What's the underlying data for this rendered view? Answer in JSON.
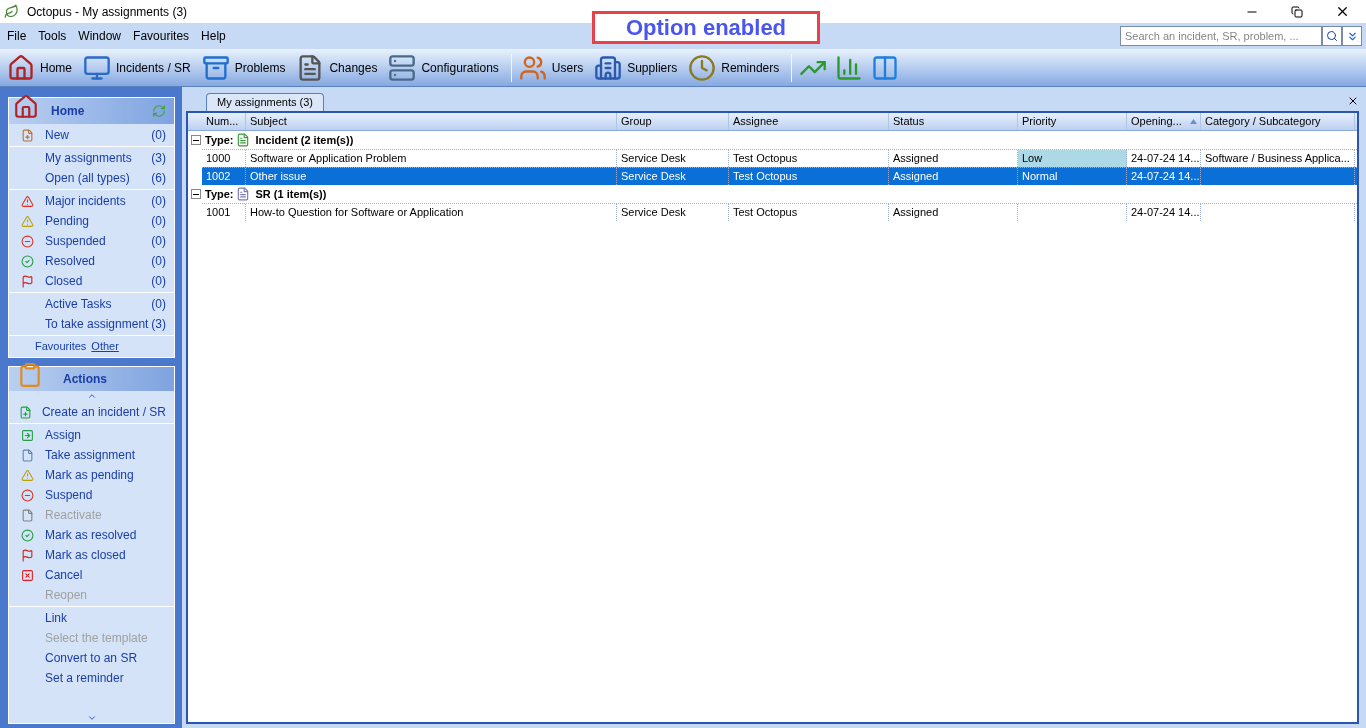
{
  "window": {
    "title": "Octopus - My assignments (3)"
  },
  "annotation": {
    "text": "Option enabled"
  },
  "menu": [
    "File",
    "Tools",
    "Window",
    "Favourites",
    "Help"
  ],
  "search": {
    "placeholder": "Search an incident, SR, problem, ..."
  },
  "toolbar": [
    {
      "kind": "home",
      "label": "Home"
    },
    {
      "kind": "incidents",
      "label": "Incidents / SR"
    },
    {
      "kind": "problems",
      "label": "Problems"
    },
    {
      "kind": "changes",
      "label": "Changes"
    },
    {
      "kind": "configurations",
      "label": "Configurations"
    },
    {
      "kind": "separator"
    },
    {
      "kind": "users",
      "label": "Users"
    },
    {
      "kind": "suppliers",
      "label": "Suppliers"
    },
    {
      "kind": "reminders",
      "label": "Reminders"
    },
    {
      "kind": "separator"
    },
    {
      "kind": "line-chart"
    },
    {
      "kind": "bar-chart"
    },
    {
      "kind": "columns"
    }
  ],
  "home_panel": {
    "title": "Home",
    "groups": [
      [
        {
          "kind": "new",
          "label": "New",
          "count": "(0)"
        }
      ],
      [
        {
          "kind": "plain",
          "label": "My assignments",
          "count": "(3)"
        },
        {
          "kind": "plain",
          "label": "Open (all types)",
          "count": "(6)"
        }
      ],
      [
        {
          "kind": "major",
          "label": "Major incidents",
          "count": "(0)"
        },
        {
          "kind": "pending",
          "label": "Pending",
          "count": "(0)"
        },
        {
          "kind": "suspend",
          "label": "Suspended",
          "count": "(0)"
        },
        {
          "kind": "resolved",
          "label": "Resolved",
          "count": "(0)"
        },
        {
          "kind": "closed",
          "label": "Closed",
          "count": "(0)"
        }
      ],
      [
        {
          "kind": "plain",
          "label": "Active Tasks",
          "count": "(0)"
        },
        {
          "kind": "plain",
          "label": "To take assignment",
          "count": "(3)"
        }
      ]
    ],
    "favourites": "Favourites",
    "other": "Other"
  },
  "actions_panel": {
    "title": "Actions",
    "groups": [
      [
        {
          "kind": "create",
          "label": "Create an incident / SR",
          "disabled": false
        }
      ],
      [
        {
          "kind": "assign",
          "label": "Assign",
          "disabled": false
        },
        {
          "kind": "take",
          "label": "Take assignment",
          "disabled": false
        },
        {
          "kind": "pending",
          "label": "Mark as pending",
          "disabled": false
        },
        {
          "kind": "suspend",
          "label": "Suspend",
          "disabled": false
        },
        {
          "kind": "reactivate",
          "label": "Reactivate",
          "disabled": true
        },
        {
          "kind": "resolved",
          "label": "Mark as resolved",
          "disabled": false
        },
        {
          "kind": "closed",
          "label": "Mark as closed",
          "disabled": false
        },
        {
          "kind": "cancel",
          "label": "Cancel",
          "disabled": false
        },
        {
          "kind": "plain",
          "label": "Reopen",
          "disabled": true
        }
      ],
      [
        {
          "kind": "plain",
          "label": "Link",
          "disabled": false
        },
        {
          "kind": "plain",
          "label": "Select the template",
          "disabled": true
        },
        {
          "kind": "plain",
          "label": "Convert to an SR",
          "disabled": false
        },
        {
          "kind": "plain",
          "label": "Set a reminder",
          "disabled": false
        }
      ]
    ]
  },
  "tab": {
    "label": "My assignments (3)",
    "selected": true
  },
  "table": {
    "columns": [
      "Num...",
      "Subject",
      "Group",
      "Assignee",
      "Status",
      "Priority",
      "Opening...",
      "Category / Subcategory"
    ],
    "groups": [
      {
        "kind": "incident",
        "type_label": "Type:",
        "name": "Incident (2 item(s))",
        "expanded": true,
        "rows": [
          {
            "number": "1000",
            "subject": "Software or Application Problem",
            "group": "Service Desk",
            "assignee": "Test Octopus",
            "status": "Assigned",
            "priority": {
              "text": "Low",
              "color": "#add8e6"
            },
            "opening": "24-07-24 14...",
            "category": "Software / Business Applica...",
            "selected": false
          },
          {
            "number": "1002",
            "subject": "Other issue",
            "group": "Service Desk",
            "assignee": "Test Octopus",
            "status": "Assigned",
            "priority": {
              "text": "Normal"
            },
            "opening": "24-07-24 14...",
            "selected": true
          }
        ]
      },
      {
        "kind": "sr",
        "type_label": "Type:",
        "name": "SR (1 item(s))",
        "expanded": true,
        "rows": [
          {
            "number": "1001",
            "subject": "How-to Question for Software or Application",
            "group": "Service Desk",
            "assignee": "Test Octopus",
            "status": "Assigned",
            "opening": "24-07-24 14...",
            "selected": false
          }
        ]
      }
    ]
  }
}
